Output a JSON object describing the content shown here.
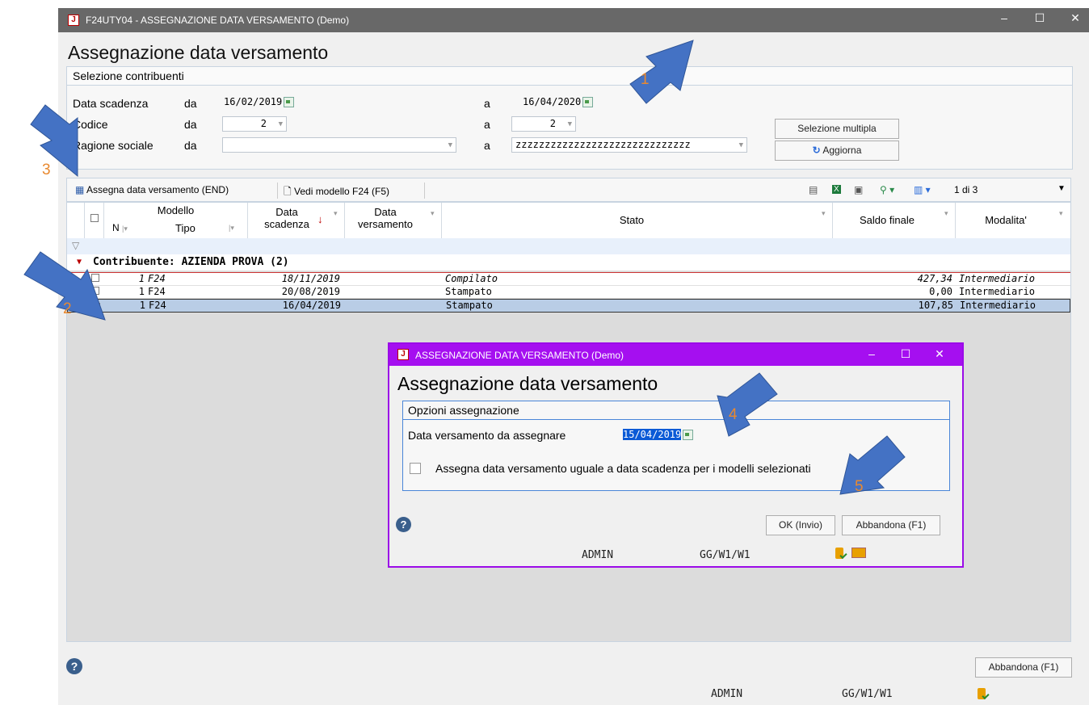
{
  "window": {
    "title": "F24UTY04 - ASSEGNAZIONE DATA VERSAMENTO  (Demo)",
    "heading": "Assegnazione data versamento",
    "icon": "app-logo-icon"
  },
  "selection": {
    "group_title": "Selezione contribuenti",
    "rows": [
      {
        "label": "Data scadenza",
        "from_label": "da",
        "from": "16/02/2019",
        "to_label": "a",
        "to": "16/04/2020"
      },
      {
        "label": "Codice",
        "from_label": "da",
        "from": "2",
        "to_label": "a",
        "to": "2"
      },
      {
        "label": "Ragione sociale",
        "from_label": "da",
        "from": "",
        "to_label": "a",
        "to": "zzzzzzzzzzzzzzzzzzzzzzzzzzzzzz"
      }
    ],
    "multi_button": "Selezione multipla",
    "refresh_button": "Aggiorna"
  },
  "toolbar": {
    "assign": "Assegna data versamento (END)",
    "view": "Vedi modello F24 (F5)",
    "pager": "1 di 3"
  },
  "grid": {
    "headers": {
      "modello": "Modello",
      "n": "N",
      "tipo": "Tipo",
      "data_scadenza_1": "Data",
      "data_scadenza_2": "scadenza",
      "data_versamento_1": "Data",
      "data_versamento_2": "versamento",
      "stato": "Stato",
      "saldo": "Saldo finale",
      "modalita": "Modalita'"
    },
    "group_row": "Contribuente: AZIENDA PROVA (2)",
    "rows": [
      {
        "checked": false,
        "n": "1",
        "tipo": "F24",
        "scadenza": "18/11/2019",
        "versamento": "",
        "stato": "Compilato",
        "saldo": "427,34",
        "modalita": "Intermediario"
      },
      {
        "checked": false,
        "n": "1",
        "tipo": "F24",
        "scadenza": "20/08/2019",
        "versamento": "",
        "stato": "Stampato",
        "saldo": "0,00",
        "modalita": "Intermediario"
      },
      {
        "checked": true,
        "n": "1",
        "tipo": "F24",
        "scadenza": "16/04/2019",
        "versamento": "",
        "stato": "Stampato",
        "saldo": "107,85",
        "modalita": "Intermediario"
      }
    ]
  },
  "footer": {
    "cancel": "Abbandona (F1)",
    "user": "ADMIN",
    "context": "GG/W1/W1"
  },
  "dialog": {
    "title": "ASSEGNAZIONE DATA VERSAMENTO  (Demo)",
    "heading": "Assegnazione data versamento",
    "group_title": "Opzioni assegnazione",
    "date_label": "Data versamento da assegnare",
    "date_value": "15/04/2019",
    "checkbox_label": "Assegna data versamento uguale a data scadenza per i modelli selezionati",
    "ok": "OK (Invio)",
    "cancel": "Abbandona (F1)",
    "user": "ADMIN",
    "context": "GG/W1/W1"
  },
  "annotations": [
    "1",
    "2",
    "3",
    "4",
    "5"
  ],
  "colors": {
    "annotation_arrow": "#4472c4",
    "annotation_number": "#e9892f",
    "dialog_accent": "#a50ff0",
    "titlebar": "#686868"
  }
}
